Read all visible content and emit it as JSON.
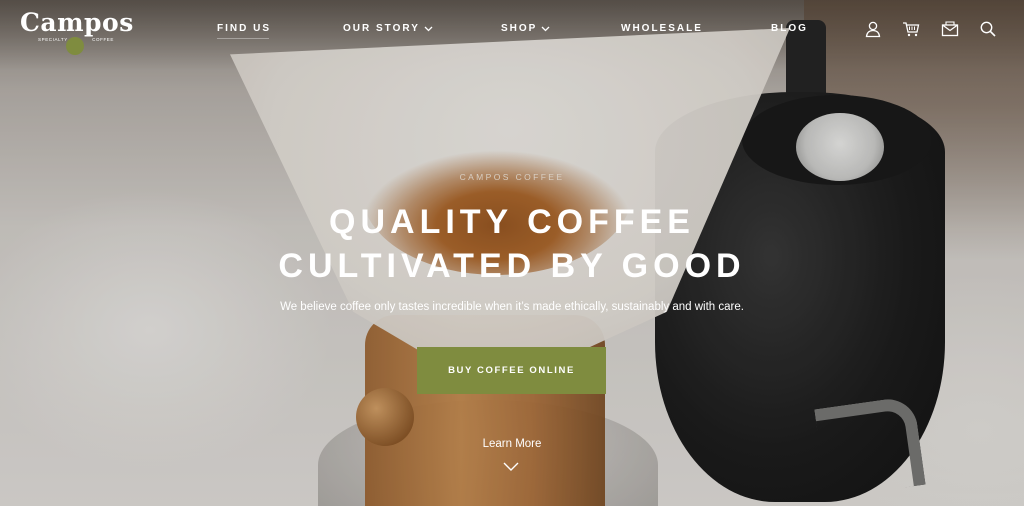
{
  "brand": {
    "name": "Campos",
    "tag_left": "SPECIALTY",
    "tag_right": "COFFEE",
    "accent_color": "#7f8c3f"
  },
  "nav": {
    "items": [
      {
        "label": "FIND US",
        "has_dropdown": false
      },
      {
        "label": "OUR STORY",
        "has_dropdown": true
      },
      {
        "label": "SHOP",
        "has_dropdown": true
      },
      {
        "label": "WHOLESALE",
        "has_dropdown": false
      },
      {
        "label": "BLOG",
        "has_dropdown": false
      }
    ],
    "icons": [
      "user-icon",
      "cart-icon",
      "mail-icon",
      "search-icon"
    ]
  },
  "hero": {
    "eyebrow": "CAMPOS COFFEE",
    "headline_line1": "QUALITY COFFEE",
    "headline_line2": "CULTIVATED BY GOOD",
    "subline": "We believe coffee only tastes incredible when it’s made ethically, sustainably and with care.",
    "cta_label": "BUY COFFEE ONLINE",
    "learn_more": "Learn More"
  }
}
